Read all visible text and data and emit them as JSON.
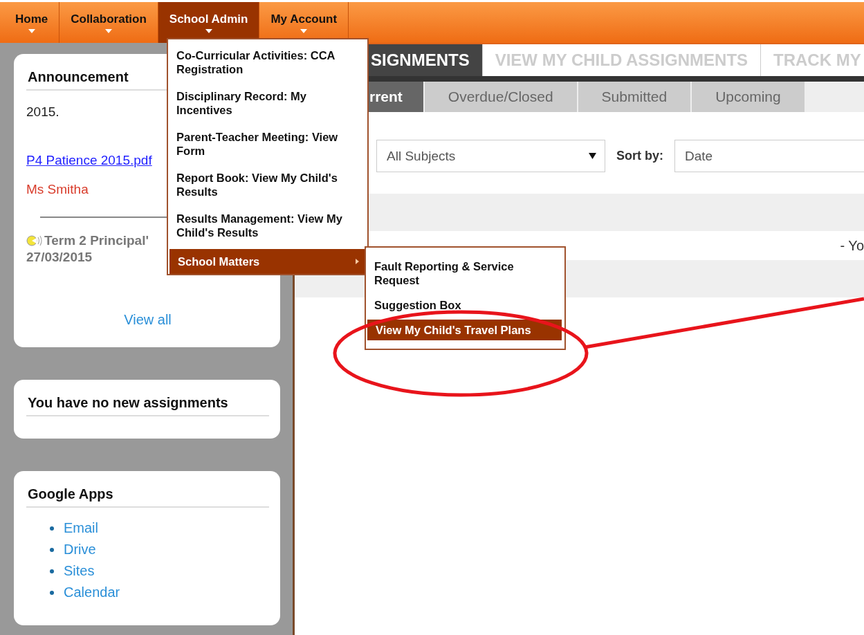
{
  "nav": [
    {
      "label": "Home",
      "selected": false
    },
    {
      "label": "Collaboration",
      "selected": false
    },
    {
      "label": "School Admin",
      "selected": true
    },
    {
      "label": "My Account",
      "selected": false
    }
  ],
  "dropdown": [
    {
      "label": "Co-Curricular Activities: CCA Registration",
      "selected": false,
      "submenu": false
    },
    {
      "label": "Disciplinary Record: My Incentives",
      "selected": false,
      "submenu": false
    },
    {
      "label": "Parent-Teacher Meeting: View Form",
      "selected": false,
      "submenu": false
    },
    {
      "label": "Report Book: View My Child's Results",
      "selected": false,
      "submenu": false
    },
    {
      "label": "Results Management: View My Child's Results",
      "selected": false,
      "submenu": false
    },
    {
      "label": "School Matters",
      "selected": true,
      "submenu": true
    }
  ],
  "submenu": [
    {
      "label": "Fault Reporting & Service Request",
      "selected": false
    },
    {
      "label": "Suggestion Box",
      "selected": false
    },
    {
      "label": "View My Child's Travel Plans",
      "selected": true
    }
  ],
  "announcement": {
    "title": "Announcement",
    "text": "2015.",
    "link": "P4 Patience 2015.pdf",
    "author": "Ms Smitha",
    "item_title": "Term 2 Principal'",
    "item_date": "27/03/2015",
    "view_all": "View all"
  },
  "assignments_card": {
    "title": "You have no new assignments"
  },
  "google_apps": {
    "title": "Google Apps",
    "links": [
      "Email",
      "Drive",
      "Sites",
      "Calendar"
    ]
  },
  "tabs": [
    {
      "label": "SIGNMENTS",
      "selected": true
    },
    {
      "label": "VIEW MY CHILD ASSIGNMENTS",
      "selected": false
    },
    {
      "label": "TRACK MY",
      "selected": false
    }
  ],
  "subtabs": [
    {
      "label": "rrent",
      "selected": true
    },
    {
      "label": "Overdue/Closed",
      "selected": false
    },
    {
      "label": "Submitted",
      "selected": false
    },
    {
      "label": "Upcoming",
      "selected": false
    }
  ],
  "filter": {
    "subject": "All Subjects",
    "sort_label": "Sort by:",
    "sort_value": "Date"
  },
  "rows": [
    {
      "text": ""
    },
    {
      "text": "- Yo"
    },
    {
      "text": ""
    }
  ]
}
